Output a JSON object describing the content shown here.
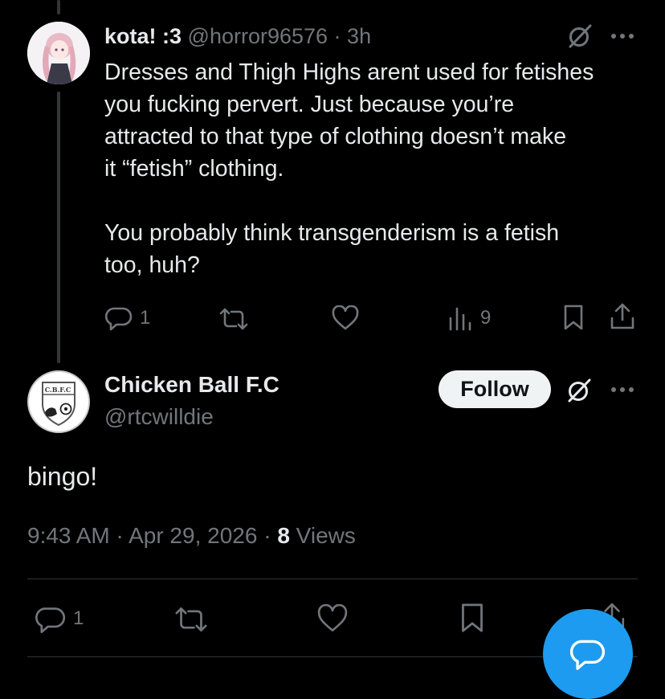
{
  "parent_post": {
    "display_name": "kota! :3",
    "handle_time": "@horror96576 · 3h",
    "text": "Dresses and Thigh Highs arent used for fetishes\nyou fucking pervert. Just because you’re\nattracted to that type of clothing doesn’t make\nit “fetish” clothing.\n\nYou probably think transgenderism is a fetish\ntoo, huh?",
    "replies": "1",
    "views": "9"
  },
  "main_post": {
    "display_name": "Chicken Ball F.C",
    "handle": "@rtcwilldie",
    "follow_label": "Follow",
    "text": "bingo!",
    "time": "9:43 AM",
    "date": "Apr 29, 2026",
    "views_count": "8",
    "views_label": "Views",
    "replies": "1",
    "avatar_badge_text": "C.B.F.C"
  },
  "colors": {
    "background": "#000000",
    "text": "#e7e9ea",
    "muted": "#71767b",
    "divider": "#2f3336",
    "follow_bg": "#eff3f4",
    "accent": "#1d9bf0"
  },
  "icons": [
    "reply-icon",
    "retweet-icon",
    "like-icon",
    "views-icon",
    "bookmark-icon",
    "share-icon",
    "grok-icon",
    "more-icon",
    "compose-icon"
  ]
}
